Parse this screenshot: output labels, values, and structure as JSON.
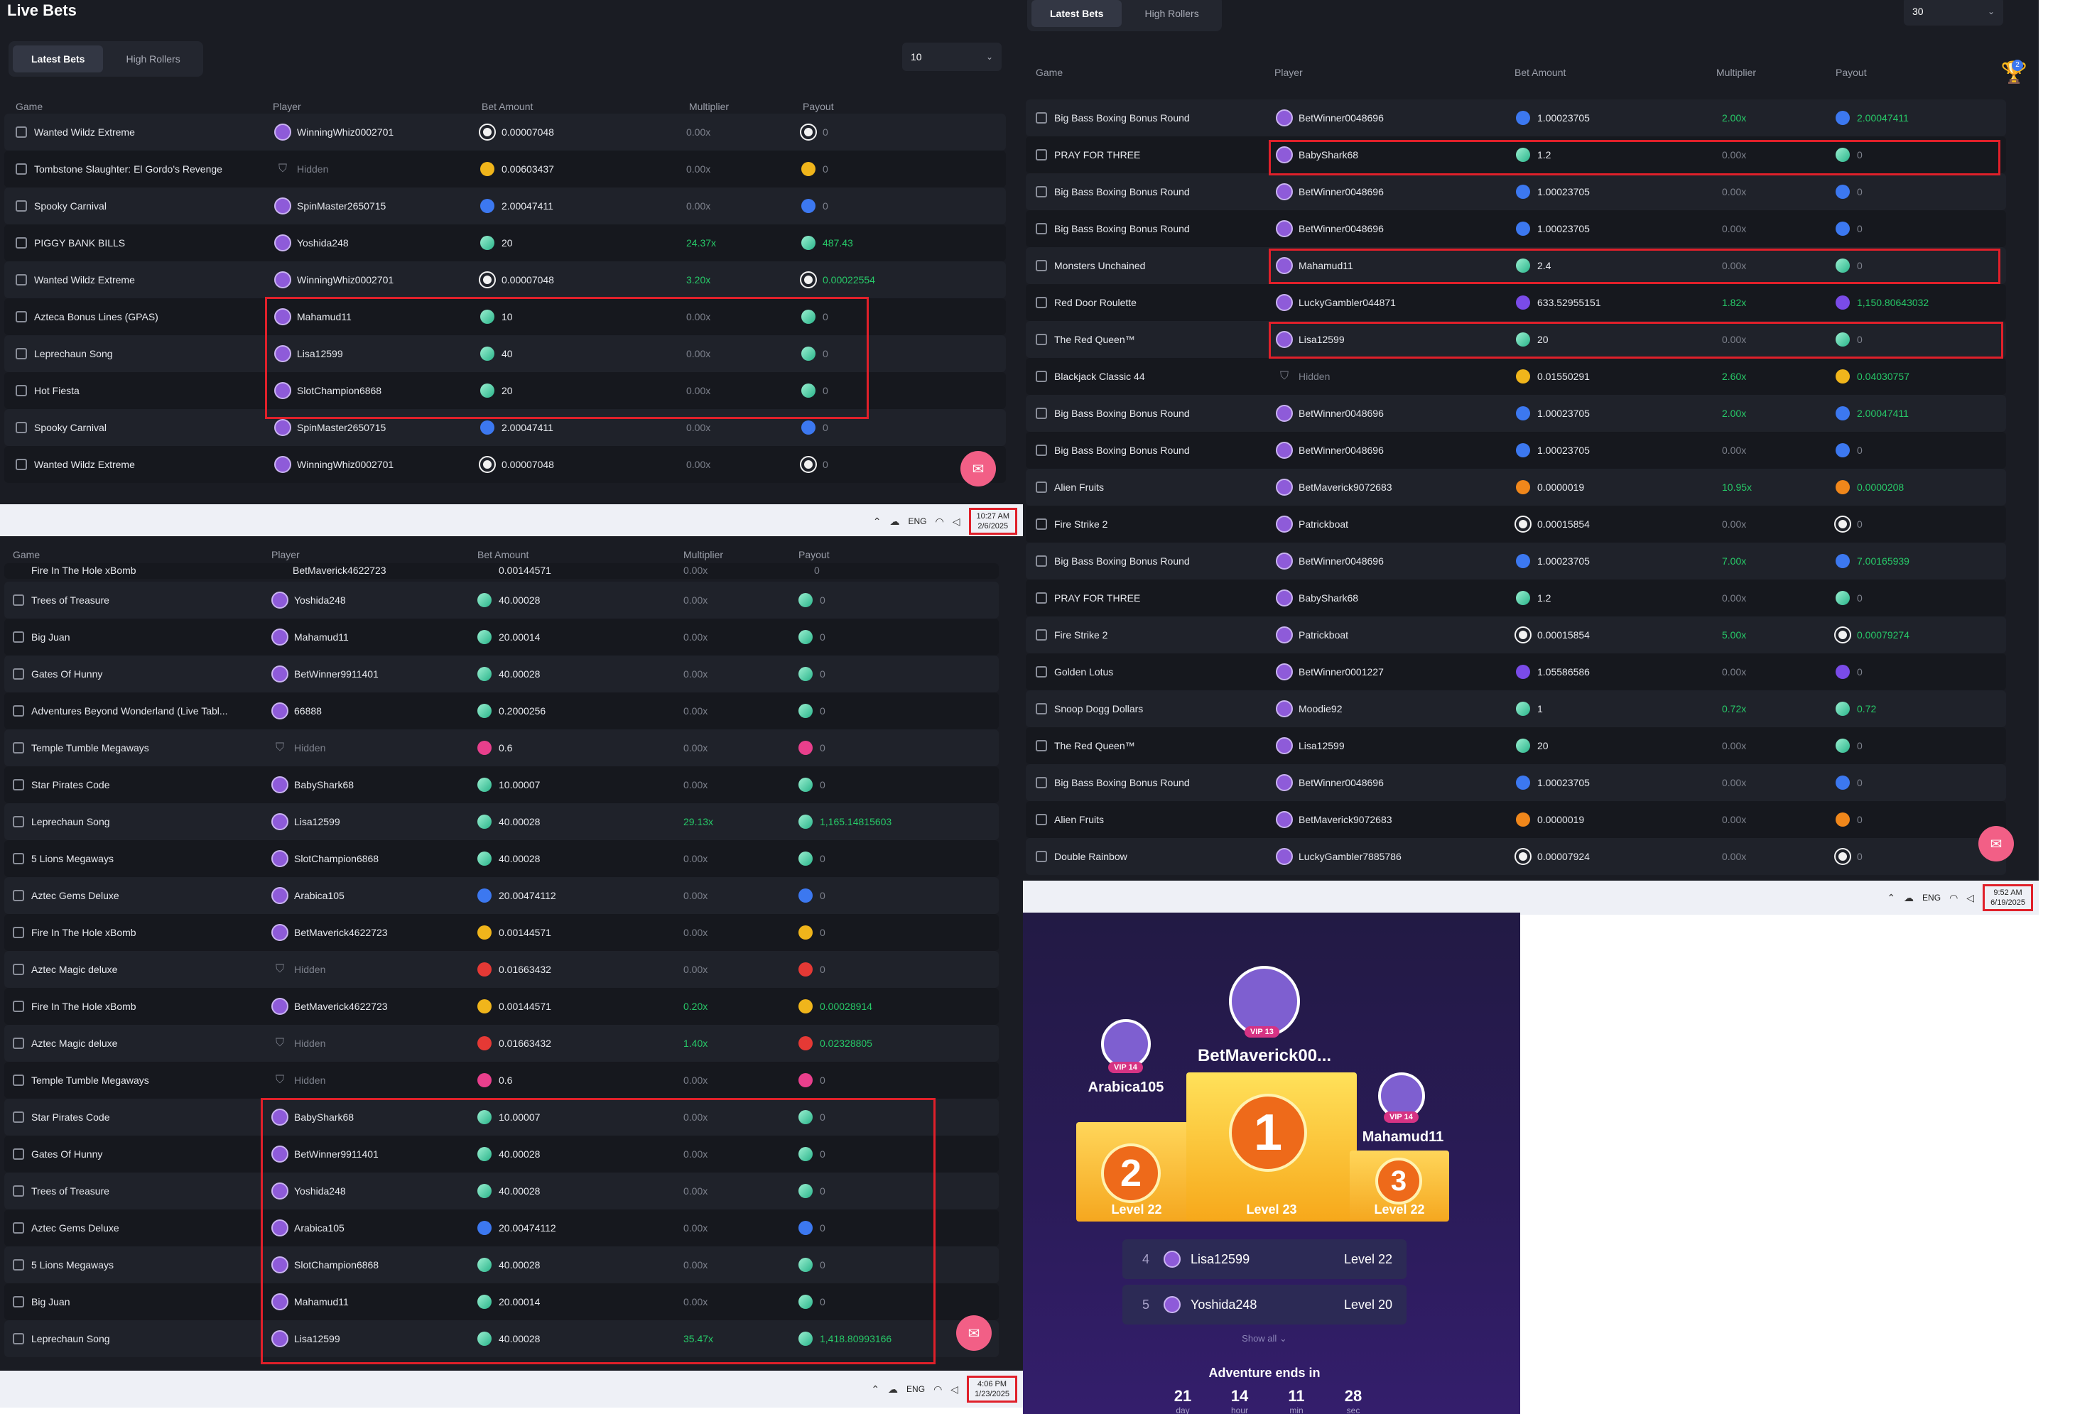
{
  "panel1": {
    "title": "Live Bets",
    "tabs": [
      "Latest Bets",
      "High Rollers"
    ],
    "count": "10",
    "columns": [
      "Game",
      "Player",
      "Bet Amount",
      "Multiplier",
      "Payout"
    ],
    "rows": [
      {
        "game": "Wanted Wildz Extreme",
        "player": "WinningWhiz0002701",
        "bet": "0.00007048",
        "mult": "0.00x",
        "payout": "0",
        "coin": "btc",
        "win": false
      },
      {
        "game": "Tombstone Slaughter: El Gordo's Revenge",
        "player": "Hidden",
        "bet": "0.00603437",
        "mult": "0.00x",
        "payout": "0",
        "coin": "gold",
        "win": false,
        "hidden": true
      },
      {
        "game": "Spooky Carnival",
        "player": "SpinMaster2650715",
        "bet": "2.00047411",
        "mult": "0.00x",
        "payout": "0",
        "coin": "blue",
        "win": false
      },
      {
        "game": "PIGGY BANK BILLS",
        "player": "Yoshida248",
        "bet": "20",
        "mult": "24.37x",
        "payout": "487.43",
        "coin": "gem",
        "win": true
      },
      {
        "game": "Wanted Wildz Extreme",
        "player": "WinningWhiz0002701",
        "bet": "0.00007048",
        "mult": "3.20x",
        "payout": "0.00022554",
        "coin": "btc",
        "win": true
      },
      {
        "game": "Azteca Bonus Lines (GPAS)",
        "player": "Mahamud11",
        "bet": "10",
        "mult": "0.00x",
        "payout": "0",
        "coin": "gem",
        "win": false
      },
      {
        "game": "Leprechaun Song",
        "player": "Lisa12599",
        "bet": "40",
        "mult": "0.00x",
        "payout": "0",
        "coin": "gem",
        "win": false
      },
      {
        "game": "Hot Fiesta",
        "player": "SlotChampion6868",
        "bet": "20",
        "mult": "0.00x",
        "payout": "0",
        "coin": "gem",
        "win": false
      },
      {
        "game": "Spooky Carnival",
        "player": "SpinMaster2650715",
        "bet": "2.00047411",
        "mult": "0.00x",
        "payout": "0",
        "coin": "blue",
        "win": false
      },
      {
        "game": "Wanted Wildz Extreme",
        "player": "WinningWhiz0002701",
        "bet": "0.00007048",
        "mult": "0.00x",
        "payout": "0",
        "coin": "btc",
        "win": false
      }
    ],
    "taskbar": {
      "lang": "ENG",
      "time": "10:27 AM",
      "date": "2/6/2025"
    }
  },
  "panel2": {
    "tabs": [
      "Latest Bets",
      "High Rollers"
    ],
    "count": "30",
    "badge": "2",
    "columns": [
      "Game",
      "Player",
      "Bet Amount",
      "Multiplier",
      "Payout"
    ],
    "rows": [
      {
        "game": "Big Bass Boxing Bonus Round",
        "player": "BetWinner0048696",
        "bet": "1.00023705",
        "mult": "2.00x",
        "payout": "2.00047411",
        "coin": "blue",
        "win": true
      },
      {
        "game": "PRAY FOR THREE",
        "player": "BabyShark68",
        "bet": "1.2",
        "mult": "0.00x",
        "payout": "0",
        "coin": "gem",
        "win": false
      },
      {
        "game": "Big Bass Boxing Bonus Round",
        "player": "BetWinner0048696",
        "bet": "1.00023705",
        "mult": "0.00x",
        "payout": "0",
        "coin": "blue",
        "win": false
      },
      {
        "game": "Big Bass Boxing Bonus Round",
        "player": "BetWinner0048696",
        "bet": "1.00023705",
        "mult": "0.00x",
        "payout": "0",
        "coin": "blue",
        "win": false
      },
      {
        "game": "Monsters Unchained",
        "player": "Mahamud11",
        "bet": "2.4",
        "mult": "0.00x",
        "payout": "0",
        "coin": "gem",
        "win": false
      },
      {
        "game": "Red Door Roulette",
        "player": "LuckyGambler044871",
        "bet": "633.52955151",
        "mult": "1.82x",
        "payout": "1,150.80643032",
        "coin": "purple",
        "win": true
      },
      {
        "game": "The Red Queen™",
        "player": "Lisa12599",
        "bet": "20",
        "mult": "0.00x",
        "payout": "0",
        "coin": "gem",
        "win": false
      },
      {
        "game": "Blackjack Classic 44",
        "player": "Hidden",
        "bet": "0.01550291",
        "mult": "2.60x",
        "payout": "0.04030757",
        "coin": "gold",
        "win": true,
        "hidden": true
      },
      {
        "game": "Big Bass Boxing Bonus Round",
        "player": "BetWinner0048696",
        "bet": "1.00023705",
        "mult": "2.00x",
        "payout": "2.00047411",
        "coin": "blue",
        "win": true
      },
      {
        "game": "Big Bass Boxing Bonus Round",
        "player": "BetWinner0048696",
        "bet": "1.00023705",
        "mult": "0.00x",
        "payout": "0",
        "coin": "blue",
        "win": false
      },
      {
        "game": "Alien Fruits",
        "player": "BetMaverick9072683",
        "bet": "0.0000019",
        "mult": "10.95x",
        "payout": "0.0000208",
        "coin": "orange",
        "win": true
      },
      {
        "game": "Fire Strike 2",
        "player": "Patrickboat",
        "bet": "0.00015854",
        "mult": "0.00x",
        "payout": "0",
        "coin": "btc",
        "win": false
      },
      {
        "game": "Big Bass Boxing Bonus Round",
        "player": "BetWinner0048696",
        "bet": "1.00023705",
        "mult": "7.00x",
        "payout": "7.00165939",
        "coin": "blue",
        "win": true
      },
      {
        "game": "PRAY FOR THREE",
        "player": "BabyShark68",
        "bet": "1.2",
        "mult": "0.00x",
        "payout": "0",
        "coin": "gem",
        "win": false
      },
      {
        "game": "Fire Strike 2",
        "player": "Patrickboat",
        "bet": "0.00015854",
        "mult": "5.00x",
        "payout": "0.00079274",
        "coin": "btc",
        "win": true
      },
      {
        "game": "Golden Lotus",
        "player": "BetWinner0001227",
        "bet": "1.05586586",
        "mult": "0.00x",
        "payout": "0",
        "coin": "purple",
        "win": false
      },
      {
        "game": "Snoop Dogg Dollars",
        "player": "Moodie92",
        "bet": "1",
        "mult": "0.72x",
        "payout": "0.72",
        "coin": "gem",
        "win": true
      },
      {
        "game": "The Red Queen™",
        "player": "Lisa12599",
        "bet": "20",
        "mult": "0.00x",
        "payout": "0",
        "coin": "gem",
        "win": false
      },
      {
        "game": "Big Bass Boxing Bonus Round",
        "player": "BetWinner0048696",
        "bet": "1.00023705",
        "mult": "0.00x",
        "payout": "0",
        "coin": "blue",
        "win": false
      },
      {
        "game": "Alien Fruits",
        "player": "BetMaverick9072683",
        "bet": "0.0000019",
        "mult": "0.00x",
        "payout": "0",
        "coin": "orange",
        "win": false
      },
      {
        "game": "Double Rainbow",
        "player": "LuckyGambler7885786",
        "bet": "0.00007924",
        "mult": "0.00x",
        "payout": "0",
        "coin": "btc",
        "win": false
      }
    ],
    "taskbar": {
      "lang": "ENG",
      "time": "9:52 AM",
      "date": "6/19/2025"
    }
  },
  "panel3": {
    "columns": [
      "Game",
      "Player",
      "Bet Amount",
      "Multiplier",
      "Payout"
    ],
    "partial_row": {
      "game": "Fire In The Hole xBomb",
      "player": "BetMaverick4622723",
      "bet": "0.00144571",
      "mult": "0.00x",
      "payout": "0"
    },
    "rows": [
      {
        "game": "Trees of Treasure",
        "player": "Yoshida248",
        "bet": "40.00028",
        "mult": "0.00x",
        "payout": "0",
        "coin": "gem",
        "win": false
      },
      {
        "game": "Big Juan",
        "player": "Mahamud11",
        "bet": "20.00014",
        "mult": "0.00x",
        "payout": "0",
        "coin": "gem",
        "win": false
      },
      {
        "game": "Gates Of Hunny",
        "player": "BetWinner9911401",
        "bet": "40.00028",
        "mult": "0.00x",
        "payout": "0",
        "coin": "gem",
        "win": false
      },
      {
        "game": "Adventures Beyond Wonderland (Live Tabl...",
        "player": "66888",
        "bet": "0.2000256",
        "mult": "0.00x",
        "payout": "0",
        "coin": "gem",
        "win": false
      },
      {
        "game": "Temple Tumble Megaways",
        "player": "Hidden",
        "bet": "0.6",
        "mult": "0.00x",
        "payout": "0",
        "coin": "pink",
        "win": false,
        "hidden": true
      },
      {
        "game": "Star Pirates Code",
        "player": "BabyShark68",
        "bet": "10.00007",
        "mult": "0.00x",
        "payout": "0",
        "coin": "gem",
        "win": false
      },
      {
        "game": "Leprechaun Song",
        "player": "Lisa12599",
        "bet": "40.00028",
        "mult": "29.13x",
        "payout": "1,165.14815603",
        "coin": "gem",
        "win": true
      },
      {
        "game": "5 Lions Megaways",
        "player": "SlotChampion6868",
        "bet": "40.00028",
        "mult": "0.00x",
        "payout": "0",
        "coin": "gem",
        "win": false
      },
      {
        "game": "Aztec Gems Deluxe",
        "player": "Arabica105",
        "bet": "20.00474112",
        "mult": "0.00x",
        "payout": "0",
        "coin": "blue",
        "win": false
      },
      {
        "game": "Fire In The Hole xBomb",
        "player": "BetMaverick4622723",
        "bet": "0.00144571",
        "mult": "0.00x",
        "payout": "0",
        "coin": "gold",
        "win": false
      },
      {
        "game": "Aztec Magic deluxe",
        "player": "Hidden",
        "bet": "0.01663432",
        "mult": "0.00x",
        "payout": "0",
        "coin": "red",
        "win": false,
        "hidden": true
      },
      {
        "game": "Fire In The Hole xBomb",
        "player": "BetMaverick4622723",
        "bet": "0.00144571",
        "mult": "0.20x",
        "payout": "0.00028914",
        "coin": "gold",
        "win": true
      },
      {
        "game": "Aztec Magic deluxe",
        "player": "Hidden",
        "bet": "0.01663432",
        "mult": "1.40x",
        "payout": "0.02328805",
        "coin": "red",
        "win": true,
        "hidden": true
      },
      {
        "game": "Temple Tumble Megaways",
        "player": "Hidden",
        "bet": "0.6",
        "mult": "0.00x",
        "payout": "0",
        "coin": "pink",
        "win": false,
        "hidden": true
      },
      {
        "game": "Star Pirates Code",
        "player": "BabyShark68",
        "bet": "10.00007",
        "mult": "0.00x",
        "payout": "0",
        "coin": "gem",
        "win": false
      },
      {
        "game": "Gates Of Hunny",
        "player": "BetWinner9911401",
        "bet": "40.00028",
        "mult": "0.00x",
        "payout": "0",
        "coin": "gem",
        "win": false
      },
      {
        "game": "Trees of Treasure",
        "player": "Yoshida248",
        "bet": "40.00028",
        "mult": "0.00x",
        "payout": "0",
        "coin": "gem",
        "win": false
      },
      {
        "game": "Aztec Gems Deluxe",
        "player": "Arabica105",
        "bet": "20.00474112",
        "mult": "0.00x",
        "payout": "0",
        "coin": "blue",
        "win": false
      },
      {
        "game": "5 Lions Megaways",
        "player": "SlotChampion6868",
        "bet": "40.00028",
        "mult": "0.00x",
        "payout": "0",
        "coin": "gem",
        "win": false
      },
      {
        "game": "Big Juan",
        "player": "Mahamud11",
        "bet": "20.00014",
        "mult": "0.00x",
        "payout": "0",
        "coin": "gem",
        "win": false
      },
      {
        "game": "Leprechaun Song",
        "player": "Lisa12599",
        "bet": "40.00028",
        "mult": "35.47x",
        "payout": "1,418.80993166",
        "coin": "gem",
        "win": true
      }
    ],
    "taskbar": {
      "lang": "ENG",
      "time": "4:06 PM",
      "date": "1/23/2025"
    }
  },
  "leaderboard": {
    "first": {
      "name": "BetMaverick00...",
      "vip": "VIP 13",
      "rank": "1",
      "level": "Level 23"
    },
    "second": {
      "name": "Arabica105",
      "vip": "VIP 14",
      "rank": "2",
      "level": "Level 22"
    },
    "third": {
      "name": "Mahamud11",
      "vip": "VIP 14",
      "rank": "3",
      "level": "Level 22"
    },
    "list": [
      {
        "rank": "4",
        "name": "Lisa12599",
        "level": "Level 22",
        "badge": "13"
      },
      {
        "rank": "5",
        "name": "Yoshida248",
        "level": "Level 20",
        "badge": "13"
      }
    ],
    "show_all": "Show all ⌄",
    "ends_label": "Adventure ends in",
    "countdown": [
      {
        "n": "21",
        "u": "day"
      },
      {
        "n": "14",
        "u": "hour"
      },
      {
        "n": "11",
        "u": "min"
      },
      {
        "n": "28",
        "u": "sec"
      }
    ]
  }
}
